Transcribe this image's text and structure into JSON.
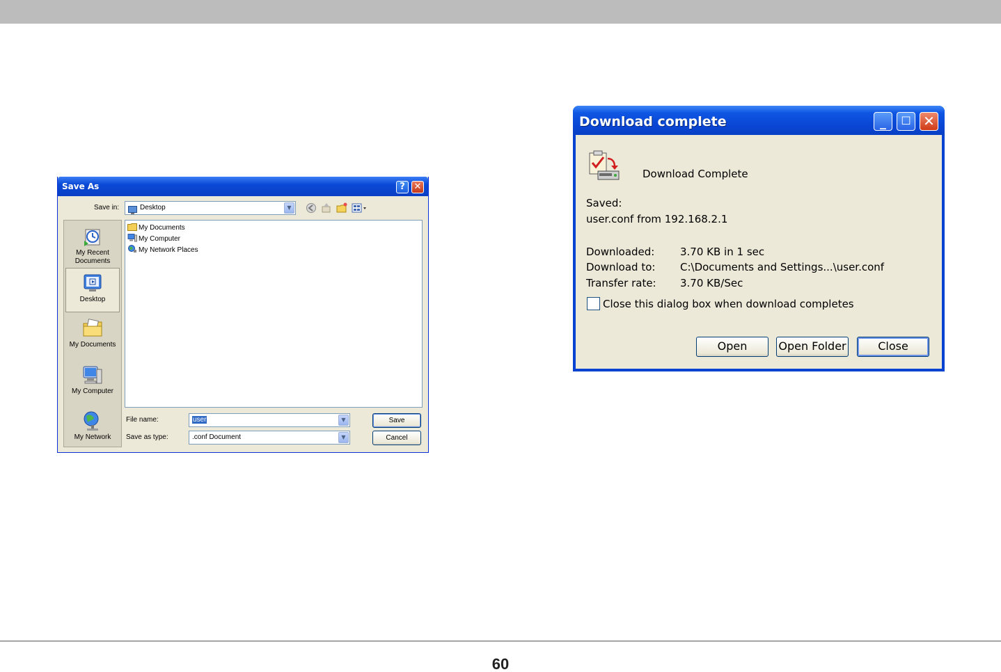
{
  "page": {
    "number": "60"
  },
  "save_as": {
    "title": "Save As",
    "help_glyph": "?",
    "close_glyph": "✕",
    "save_in_label": "Save in:",
    "save_in_value": "Desktop",
    "places": [
      {
        "label": "My Recent Documents",
        "icon": "recent-documents-icon"
      },
      {
        "label": "Desktop",
        "icon": "desktop-icon"
      },
      {
        "label": "My Documents",
        "icon": "my-documents-icon"
      },
      {
        "label": "My Computer",
        "icon": "my-computer-icon"
      },
      {
        "label": "My Network",
        "icon": "my-network-icon"
      }
    ],
    "files": [
      "My Documents",
      "My Computer",
      "My Network Places"
    ],
    "file_name_label": "File name:",
    "file_name_value": "user",
    "save_as_type_label": "Save as type:",
    "save_as_type_value": ".conf Document",
    "save_button": "Save",
    "cancel_button": "Cancel"
  },
  "download": {
    "title": "Download complete",
    "heading": "Download Complete",
    "saved_label": "Saved:",
    "saved_value": "user.conf from 192.168.2.1",
    "downloaded_label": "Downloaded:",
    "downloaded_value": "3.70 KB in 1 sec",
    "download_to_label": "Download to:",
    "download_to_value": "C:\\Documents and Settings...\\user.conf",
    "transfer_rate_label": "Transfer rate:",
    "transfer_rate_value": "3.70 KB/Sec",
    "close_when_done_label": "Close this dialog box when download completes",
    "close_when_done_checked": false,
    "open_button": "Open",
    "open_folder_button": "Open Folder",
    "close_button": "Close"
  },
  "colors": {
    "xp_title_blue": "#0a49d6",
    "xp_dialog_face": "#ece9d8",
    "xp_close_red": "#cf3a16"
  }
}
